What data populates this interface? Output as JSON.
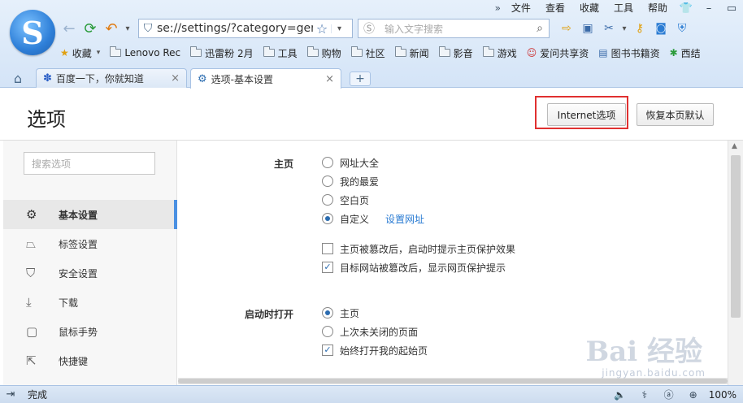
{
  "menubar": {
    "chevron": "»",
    "items": [
      "文件",
      "查看",
      "收藏",
      "工具",
      "帮助"
    ]
  },
  "nav": {
    "address_value": "se://settings/?category=gen",
    "search_placeholder": "输入文字搜索"
  },
  "favorites": {
    "star_label": "收藏",
    "items": [
      "Lenovo Rec",
      "迅雷粉 2月",
      "工具",
      "购物",
      "社区",
      "新闻",
      "影音",
      "游戏",
      "爱问共享资",
      "图书书籍资",
      "西结"
    ]
  },
  "tabs": [
    {
      "label": "百度一下，你就知道",
      "active": false
    },
    {
      "label": "选项-基本设置",
      "active": true
    }
  ],
  "page": {
    "title": "选项",
    "internet_button": "Internet选项",
    "restore_button": "恢复本页默认",
    "sidebar_search_placeholder": "搜索选项",
    "sidebar": [
      {
        "label": "基本设置",
        "icon": "gear-icon",
        "active": true
      },
      {
        "label": "标签设置",
        "icon": "tab-icon",
        "active": false
      },
      {
        "label": "安全设置",
        "icon": "shield-icon",
        "active": false
      },
      {
        "label": "下载",
        "icon": "download-icon",
        "active": false
      },
      {
        "label": "鼠标手势",
        "icon": "mouse-icon",
        "active": false
      },
      {
        "label": "快捷键",
        "icon": "shortcut-icon",
        "active": false
      }
    ],
    "homepage": {
      "label": "主页",
      "options": [
        {
          "label": "网址大全",
          "selected": false
        },
        {
          "label": "我的最爱",
          "selected": false
        },
        {
          "label": "空白页",
          "selected": false
        },
        {
          "label": "自定义",
          "selected": true
        }
      ],
      "set_url_link": "设置网址",
      "checks": [
        {
          "label": "主页被篡改后，启动时提示主页保护效果",
          "checked": false
        },
        {
          "label": "目标网站被篡改后，显示网页保护提示",
          "checked": true
        }
      ]
    },
    "startup": {
      "label": "启动时打开",
      "options": [
        {
          "label": "主页",
          "selected": true
        },
        {
          "label": "上次未关闭的页面",
          "selected": false
        }
      ],
      "check": {
        "label": "始终打开我的起始页",
        "checked": true
      }
    }
  },
  "status": {
    "text": "完成",
    "zoom": "100%"
  },
  "watermark": {
    "main": "Bai 经验",
    "sub": "jingyan.baidu.com"
  }
}
